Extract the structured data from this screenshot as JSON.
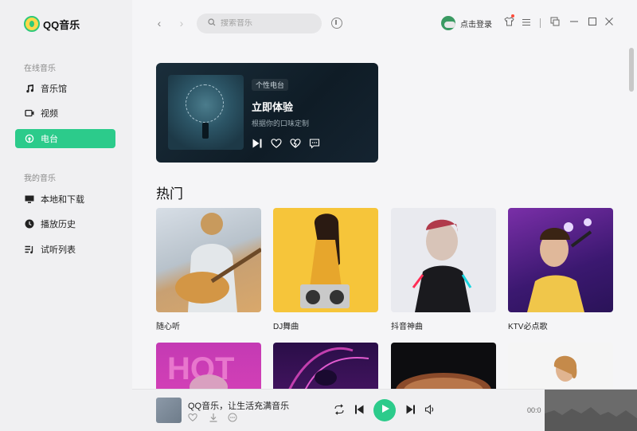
{
  "app": {
    "name": "QQ音乐"
  },
  "sidebar": {
    "online_section": "在线音乐",
    "my_section": "我的音乐",
    "online_items": [
      {
        "label": "音乐馆",
        "icon": "music-note-icon"
      },
      {
        "label": "视频",
        "icon": "video-icon"
      },
      {
        "label": "电台",
        "icon": "radio-icon",
        "active": true
      }
    ],
    "my_items": [
      {
        "label": "本地和下载",
        "icon": "monitor-icon"
      },
      {
        "label": "播放历史",
        "icon": "clock-icon"
      },
      {
        "label": "试听列表",
        "icon": "playlist-icon"
      }
    ]
  },
  "topbar": {
    "search_placeholder": "搜索音乐",
    "login_label": "点击登录"
  },
  "radio_card": {
    "tag": "个性电台",
    "title": "立即体验",
    "subtitle": "根据你的口味定制"
  },
  "hot": {
    "heading": "热门",
    "tiles": [
      {
        "label": "随心听"
      },
      {
        "label": "DJ舞曲"
      },
      {
        "label": "抖音神曲"
      },
      {
        "label": "KTV必点歌"
      }
    ]
  },
  "player": {
    "title": "QQ音乐，让生活充满音乐",
    "time": "00:0"
  },
  "colors": {
    "accent": "#2ccb8b",
    "sidebar_bg": "#f0f0f2",
    "content_bg": "#f5f5f7"
  }
}
